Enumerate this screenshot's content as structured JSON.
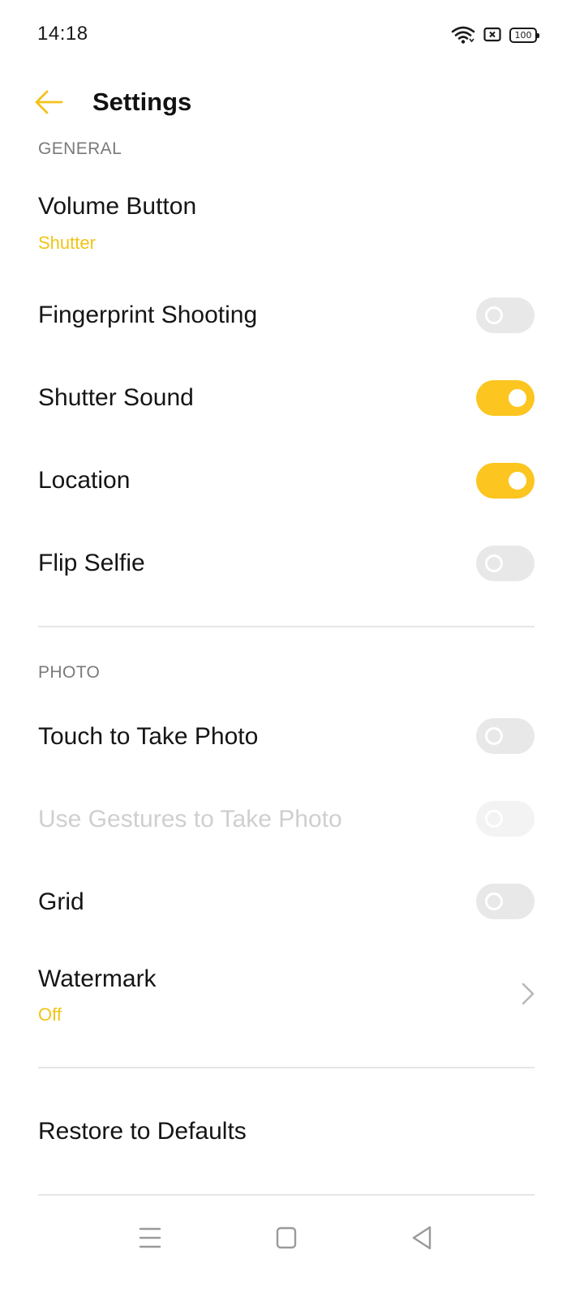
{
  "status_bar": {
    "time": "14:18",
    "battery": "100",
    "icons": [
      "wifi-icon",
      "sim-card-icon",
      "battery-icon"
    ]
  },
  "header": {
    "back_icon": "arrow-left-icon",
    "title": "Settings"
  },
  "colors": {
    "accent": "#fcc51f",
    "subtitle": "#f0c418",
    "toggle_off": "#e8e8e8",
    "section_header": "#7a7a7a",
    "disabled_text": "#cfcfcf"
  },
  "general": {
    "header": "GENERAL",
    "volume_button": {
      "label": "Volume Button",
      "value": "Shutter"
    },
    "fingerprint_shooting": {
      "label": "Fingerprint Shooting",
      "on": false
    },
    "shutter_sound": {
      "label": "Shutter Sound",
      "on": true
    },
    "location": {
      "label": "Location",
      "on": true
    },
    "flip_selfie": {
      "label": "Flip Selfie",
      "on": false
    }
  },
  "photo": {
    "header": "PHOTO",
    "touch_to_take_photo": {
      "label": "Touch to Take Photo",
      "on": false
    },
    "use_gestures": {
      "label": "Use Gestures to Take Photo",
      "on": false,
      "disabled": true
    },
    "grid": {
      "label": "Grid",
      "on": false
    },
    "watermark": {
      "label": "Watermark",
      "value": "Off"
    }
  },
  "restore": {
    "label": "Restore to Defaults"
  },
  "nav_bar": {
    "icons": [
      "menu-icon",
      "home-square-icon",
      "back-triangle-icon"
    ]
  }
}
